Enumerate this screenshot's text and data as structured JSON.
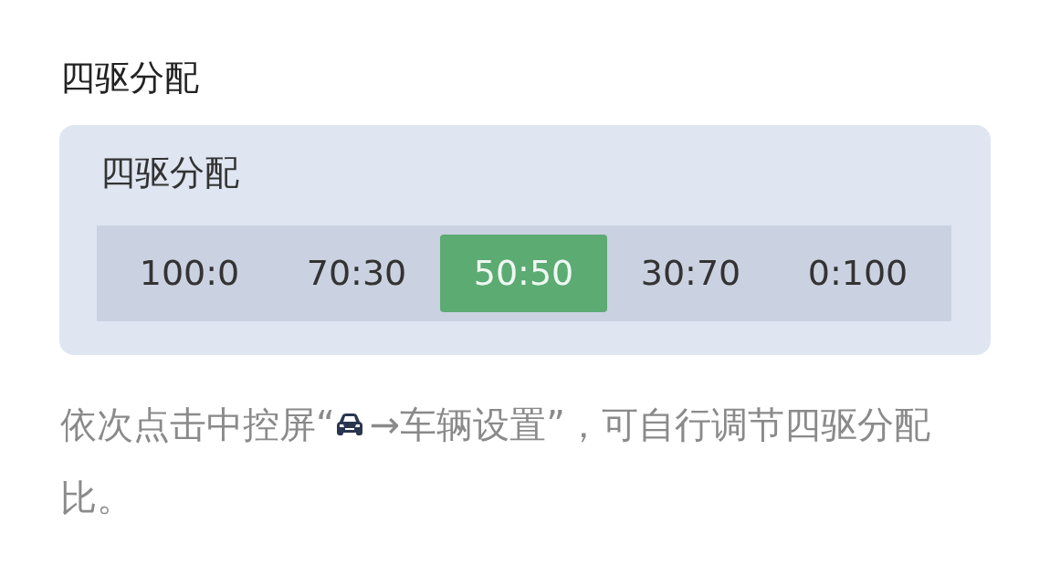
{
  "heading": "四驱分配",
  "card": {
    "title": "四驱分配",
    "options": [
      {
        "label": "100:0",
        "selected": false
      },
      {
        "label": "70:30",
        "selected": false
      },
      {
        "label": "50:50",
        "selected": true
      },
      {
        "label": "30:70",
        "selected": false
      },
      {
        "label": "0:100",
        "selected": false
      }
    ]
  },
  "instruction": {
    "before_icon": "依次点击中控屏“",
    "after_icon": "→车辆设置”，可自行调节四驱分配",
    "second_line": "比。"
  }
}
